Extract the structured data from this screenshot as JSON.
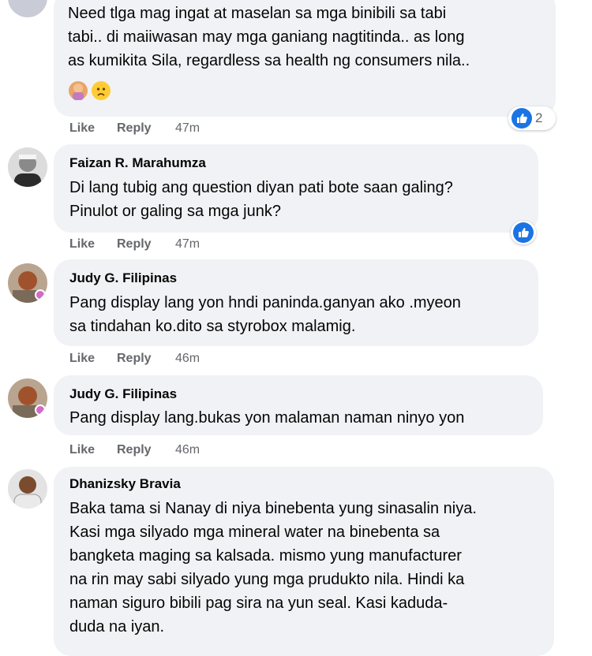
{
  "labels": {
    "like": "Like",
    "reply": "Reply"
  },
  "comments": [
    {
      "author": "",
      "text": "Need tlga mag ingat at maselan sa mga binibili sa tabi\ntabi.. di maiiwasan may mga ganiang nagtitinda.. as long\nas kumikita Sila, regardless sa health ng consumers nila..",
      "time": "47m",
      "reaction_count": "2"
    },
    {
      "author": "Faizan R. Marahumza",
      "text": "Di lang tubig ang question diyan pati bote saan galing?\nPinulot or galing sa mga junk?",
      "time": "47m",
      "reaction_count": ""
    },
    {
      "author": "Judy G. Filipinas",
      "text": "Pang display lang yon hndi paninda.ganyan ako .myeon\nsa tindahan ko.dito sa styrobox malamig.",
      "time": "46m"
    },
    {
      "author": "Judy G. Filipinas",
      "text": "Pang display lang.bukas yon malaman naman ninyo yon",
      "time": "46m"
    },
    {
      "author": "Dhanizsky Bravia",
      "text": "Baka tama si Nanay di niya binebenta yung sinasalin niya.\nKasi mga silyado mga mineral water na binebenta sa\nbangketa maging sa kalsada. mismo yung manufacturer\nna rin may sabi silyado yung mga prudukto nila. Hindi ka\nnaman siguro bibili pag sira na yun seal. Kasi kaduda-\nduda na iyan."
    }
  ],
  "colors": {
    "like_blue": "#1b74e4",
    "bubble": "#f0f2f5",
    "meta_gray": "#65676b"
  }
}
